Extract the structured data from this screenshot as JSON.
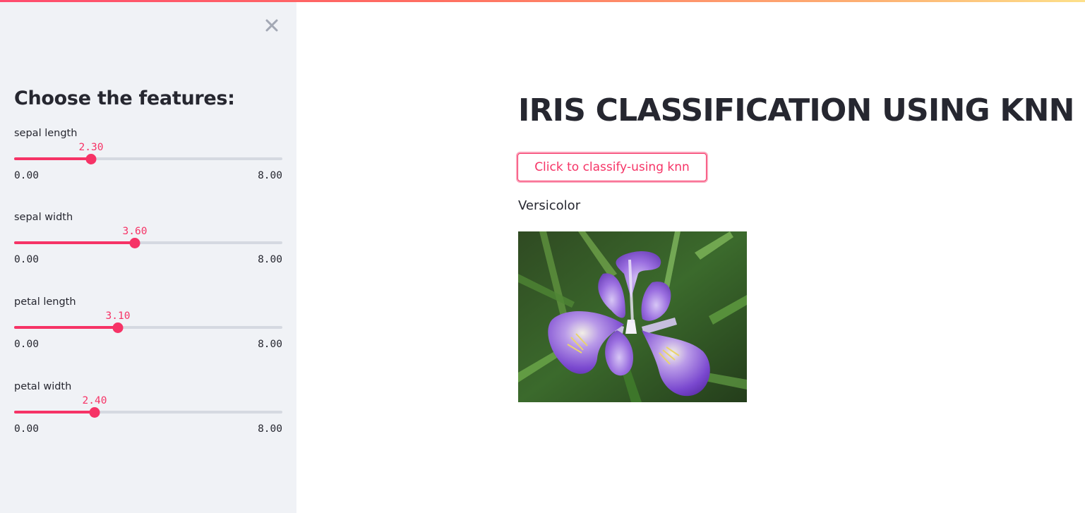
{
  "colors": {
    "accent": "#f63366",
    "sidebar_bg": "#f0f2f6",
    "track": "#d5d9e1",
    "text": "#262730"
  },
  "sidebar": {
    "close_icon": "close-icon",
    "title": "Choose the features:",
    "sliders": [
      {
        "label": "sepal length",
        "value": "2.30",
        "value_num": 2.3,
        "min": "0.00",
        "max": "8.00",
        "min_num": 0,
        "max_num": 8
      },
      {
        "label": "sepal width",
        "value": "3.60",
        "value_num": 3.6,
        "min": "0.00",
        "max": "8.00",
        "min_num": 0,
        "max_num": 8
      },
      {
        "label": "petal length",
        "value": "3.10",
        "value_num": 3.1,
        "min": "0.00",
        "max": "8.00",
        "min_num": 0,
        "max_num": 8
      },
      {
        "label": "petal width",
        "value": "2.40",
        "value_num": 2.4,
        "min": "0.00",
        "max": "8.00",
        "min_num": 0,
        "max_num": 8
      }
    ]
  },
  "main": {
    "title": "IRIS CLASSIFICATION USING KNN",
    "classify_button": "Click to classify-using knn",
    "result": "Versicolor",
    "image_icon": "iris-flower-image"
  }
}
